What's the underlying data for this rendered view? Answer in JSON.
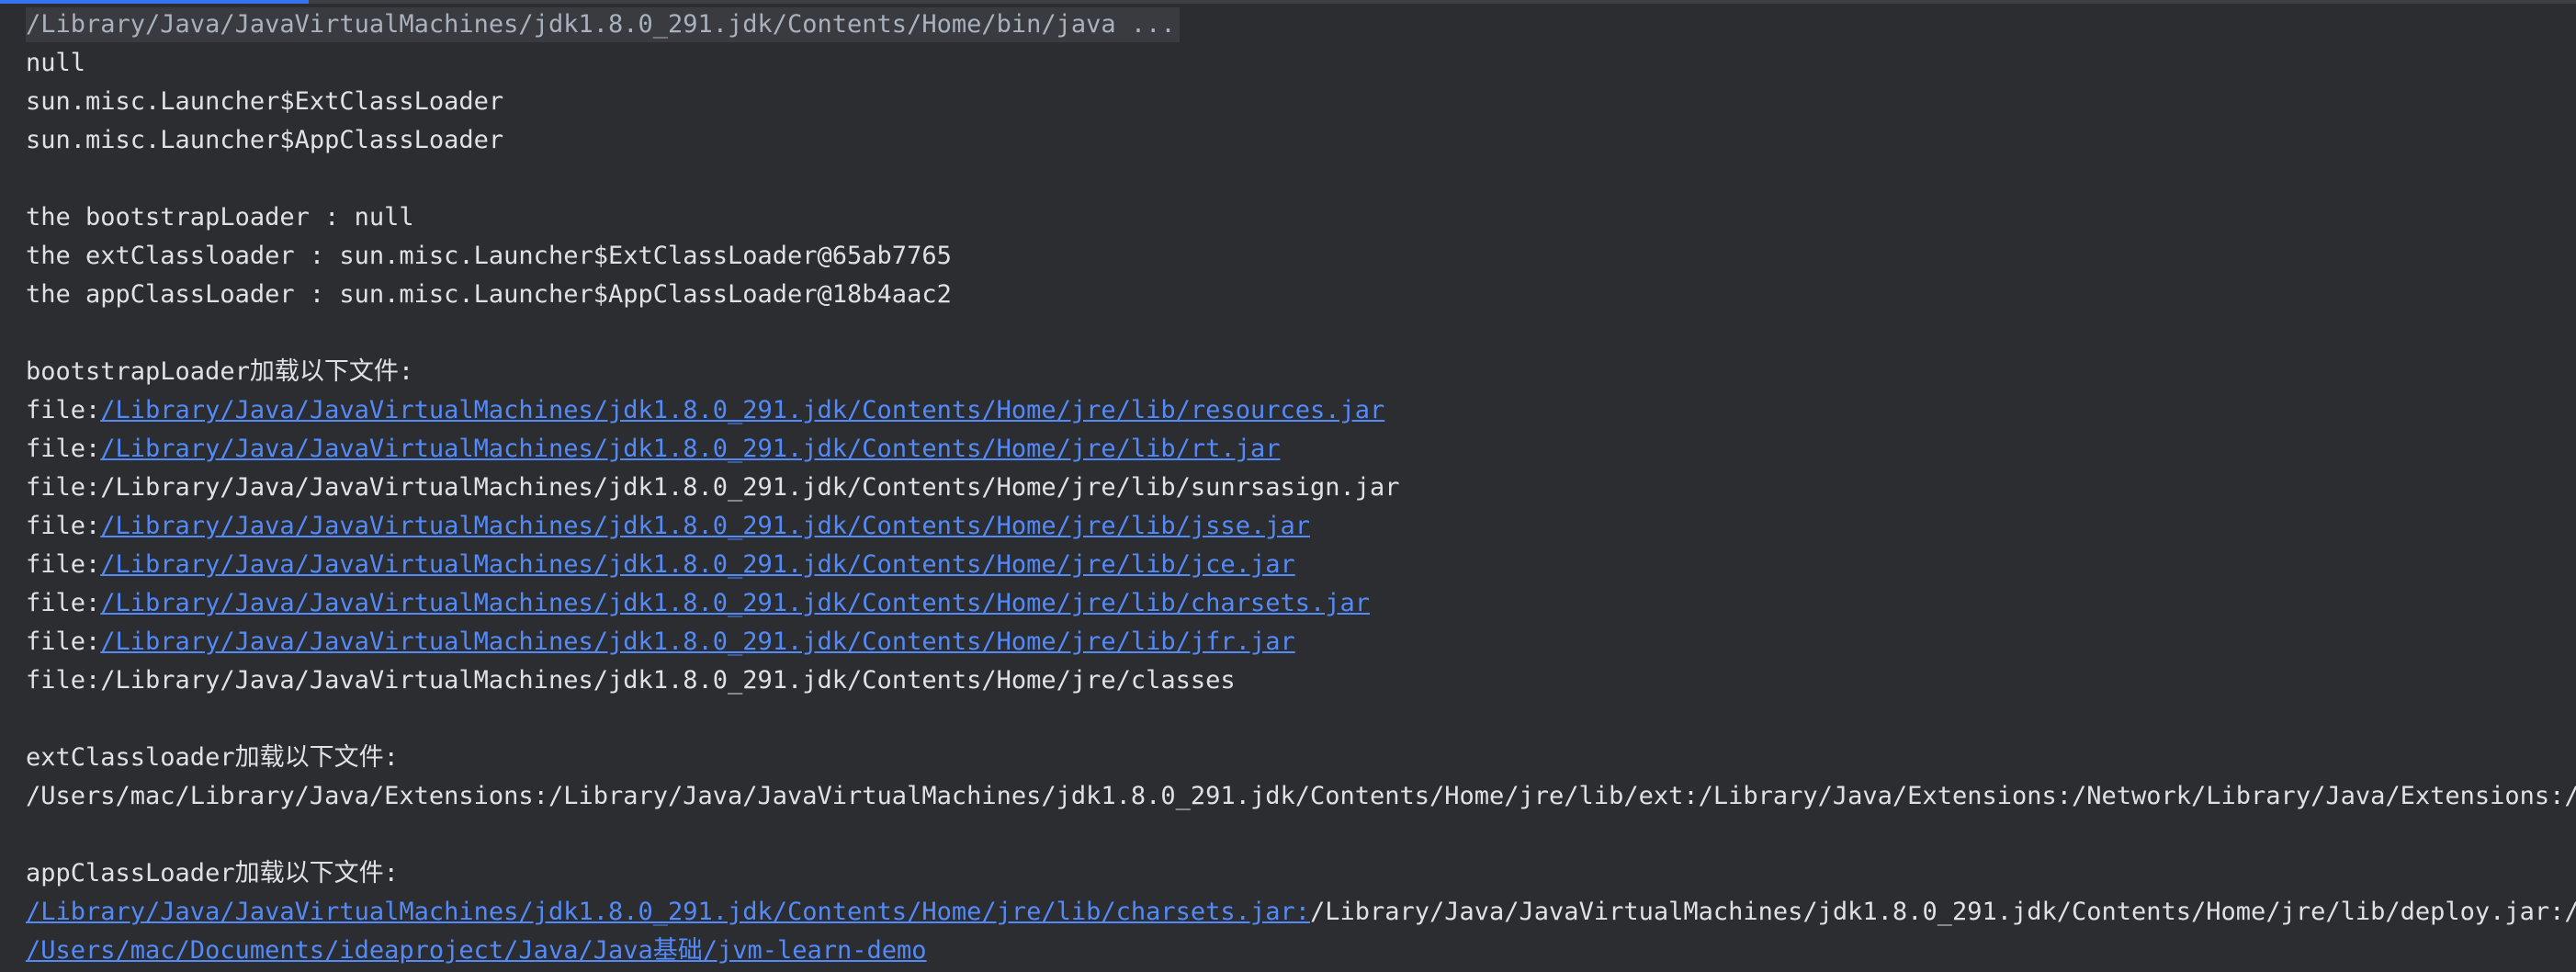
{
  "theme": {
    "background": "#2b2d30",
    "text": "#dfe1e5",
    "link": "#548af7",
    "command_bg": "#393b40",
    "command_text": "#a9b1bd",
    "progress": "#3574f0"
  },
  "progress": {
    "fraction": 0.12
  },
  "console": {
    "command": "/Library/Java/JavaVirtualMachines/jdk1.8.0_291.jdk/Contents/Home/bin/java ...",
    "null_line": "null",
    "ext_loader_class": "sun.misc.Launcher$ExtClassLoader",
    "app_loader_class": "sun.misc.Launcher$AppClassLoader",
    "bootstrap_line": "the bootstrapLoader : null",
    "ext_line": "the extClassloader : sun.misc.Launcher$ExtClassLoader@65ab7765",
    "app_line": "the appClassLoader : sun.misc.Launcher$AppClassLoader@18b4aac2",
    "bootstrap_heading": "bootstrapLoader加载以下文件:",
    "file_prefix": "file:",
    "bootstrap_files": [
      {
        "path": "/Library/Java/JavaVirtualMachines/jdk1.8.0_291.jdk/Contents/Home/jre/lib/resources.jar",
        "link": true
      },
      {
        "path": "/Library/Java/JavaVirtualMachines/jdk1.8.0_291.jdk/Contents/Home/jre/lib/rt.jar",
        "link": true
      },
      {
        "path": "/Library/Java/JavaVirtualMachines/jdk1.8.0_291.jdk/Contents/Home/jre/lib/sunrsasign.jar",
        "link": false
      },
      {
        "path": "/Library/Java/JavaVirtualMachines/jdk1.8.0_291.jdk/Contents/Home/jre/lib/jsse.jar",
        "link": true
      },
      {
        "path": "/Library/Java/JavaVirtualMachines/jdk1.8.0_291.jdk/Contents/Home/jre/lib/jce.jar",
        "link": true
      },
      {
        "path": "/Library/Java/JavaVirtualMachines/jdk1.8.0_291.jdk/Contents/Home/jre/lib/charsets.jar",
        "link": true
      },
      {
        "path": "/Library/Java/JavaVirtualMachines/jdk1.8.0_291.jdk/Contents/Home/jre/lib/jfr.jar",
        "link": true
      },
      {
        "path": "/Library/Java/JavaVirtualMachines/jdk1.8.0_291.jdk/Contents/Home/jre/classes",
        "link": false
      }
    ],
    "ext_heading": "extClassloader加载以下文件:",
    "ext_paths": "/Users/mac/Library/Java/Extensions:/Library/Java/JavaVirtualMachines/jdk1.8.0_291.jdk/Contents/Home/jre/lib/ext:/Library/Java/Extensions:/Network/Library/Java/Extensions:/Sys",
    "app_heading": "appClassLoader加载以下文件:",
    "app_classpath_link": "/Library/Java/JavaVirtualMachines/jdk1.8.0_291.jdk/Contents/Home/jre/lib/charsets.jar:",
    "app_classpath_rest": "/Library/Java/JavaVirtualMachines/jdk1.8.0_291.jdk/Contents/Home/jre/lib/deploy.jar:/Lib",
    "project_path": "/Users/mac/Documents/ideaproject/Java/Java基础/jvm-learn-demo"
  }
}
